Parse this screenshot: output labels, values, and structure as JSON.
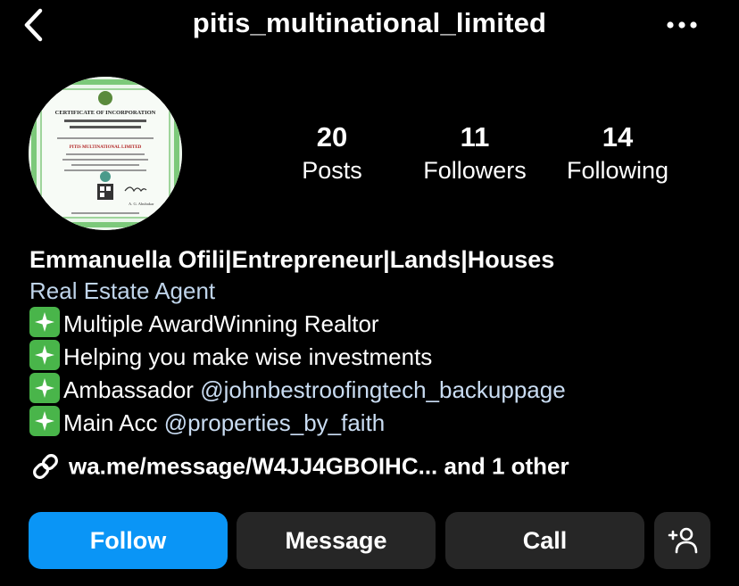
{
  "header": {
    "username": "pitis_multinational_limited",
    "back_icon": "chevron-left-icon",
    "more_icon": "more-horizontal-icon"
  },
  "avatar": {
    "certificate_heading": "CERTIFICATE OF INCORPORATION",
    "company_name": "PITIS MULTINATIONAL LIMITED",
    "signatory": "A. G. Abubakar"
  },
  "stats": [
    {
      "count": "20",
      "label": "Posts"
    },
    {
      "count": "11",
      "label": "Followers"
    },
    {
      "count": "14",
      "label": "Following"
    }
  ],
  "bio": {
    "name": "Emmanuella Ofili|Entrepreneur|Lands|Houses",
    "category": "Real Estate Agent",
    "lines": [
      {
        "prefix": "Multiple AwardWinning Realtor",
        "mention": ""
      },
      {
        "prefix": "Helping you make wise investments",
        "mention": ""
      },
      {
        "prefix": "Ambassador ",
        "mention": "@johnbestroofingtech_backuppage"
      },
      {
        "prefix": "Main Acc ",
        "mention": "@properties_by_faith"
      }
    ],
    "line_icon": "sparkles-emoji-icon"
  },
  "link": {
    "text": "wa.me/message/W4JJ4GBOIHC...  and 1 other",
    "icon": "link-icon"
  },
  "actions": {
    "follow": "Follow",
    "message": "Message",
    "call": "Call",
    "add_icon": "add-user-icon"
  },
  "colors": {
    "background": "#000000",
    "follow_button": "#0a95f6",
    "secondary_button": "#262626",
    "category_text": "#bfd4ea",
    "mention_text": "#c9dcf2",
    "sparkle_emoji": "#49b54a"
  }
}
